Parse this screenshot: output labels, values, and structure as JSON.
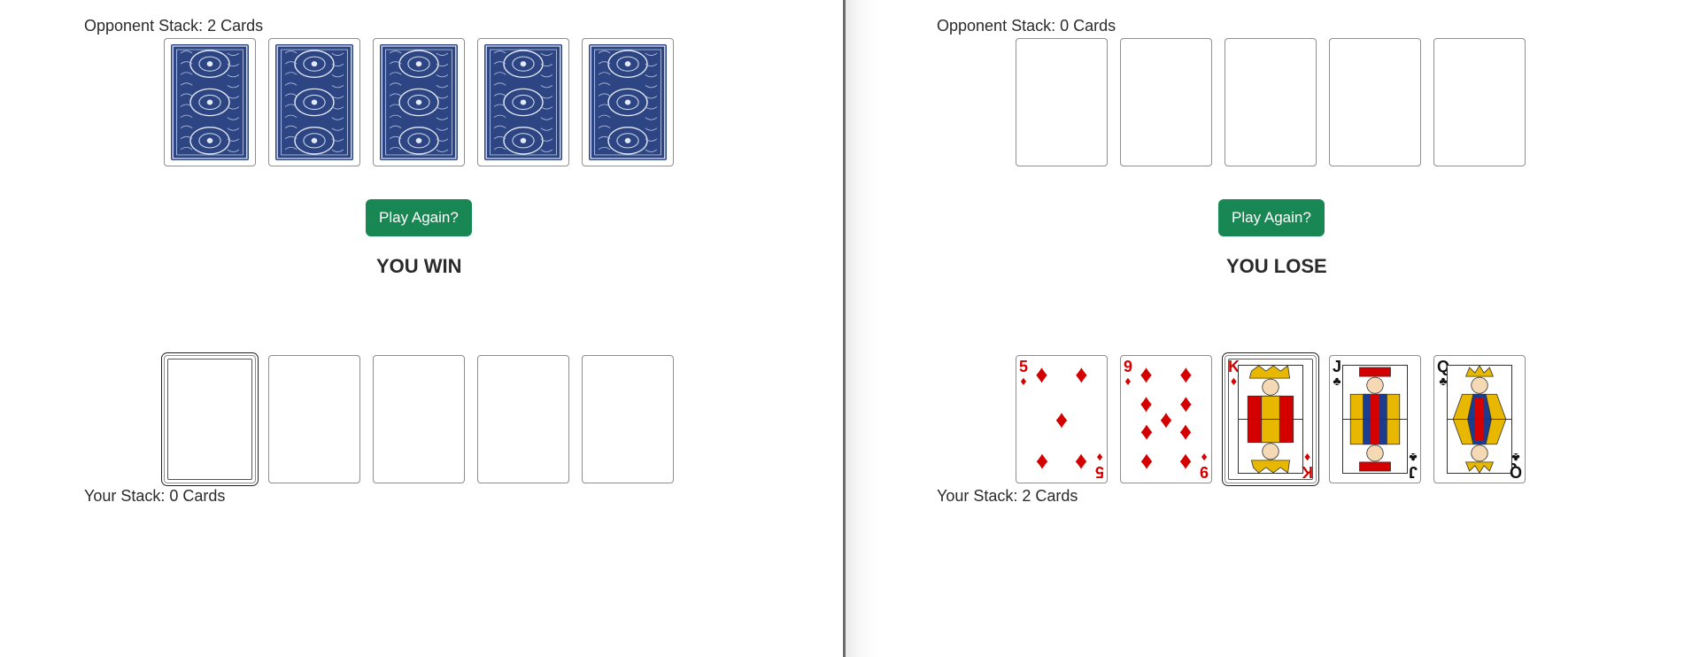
{
  "left": {
    "opponent_label": "Opponent Stack: 2 Cards",
    "your_label": "Your Stack: 0 Cards",
    "play_again": "Play Again?",
    "result": "YOU WIN",
    "opponent_cards": [
      "back",
      "back",
      "back",
      "back",
      "back"
    ],
    "player_cards": [
      "empty",
      "empty",
      "empty",
      "empty",
      "empty"
    ]
  },
  "right": {
    "opponent_label": "Opponent Stack: 0 Cards",
    "your_label": "Your Stack: 2 Cards",
    "play_again": "Play Again?",
    "result": "YOU LOSE",
    "opponent_cards": [
      "empty",
      "empty",
      "empty",
      "empty",
      "empty"
    ],
    "player_cards": [
      {
        "rank": "5",
        "suit": "♦",
        "color": "red"
      },
      {
        "rank": "9",
        "suit": "♦",
        "color": "red"
      },
      {
        "rank": "K",
        "suit": "♦",
        "color": "red"
      },
      {
        "rank": "J",
        "suit": "♣",
        "color": "black"
      },
      {
        "rank": "Q",
        "suit": "♣",
        "color": "black"
      }
    ]
  },
  "colors": {
    "button": "#198754",
    "card_back": "#2d4582",
    "red_suit": "#d40000"
  }
}
